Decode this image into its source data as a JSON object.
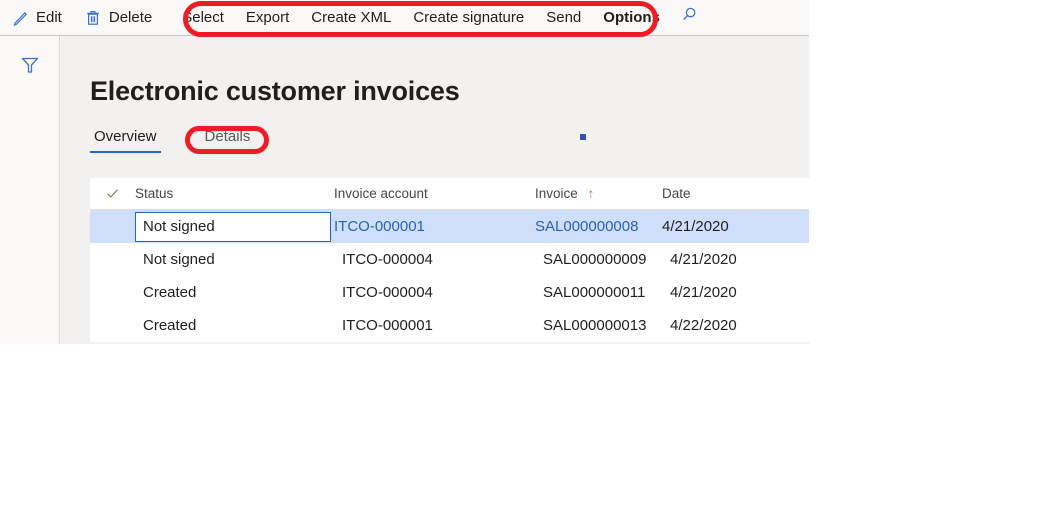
{
  "toolbar": {
    "items": [
      {
        "label": "Edit",
        "icon": "pencil-icon",
        "name": "edit-button",
        "bold": false
      },
      {
        "label": "Delete",
        "icon": "trash-icon",
        "name": "delete-button",
        "bold": false
      },
      {
        "label": "Select",
        "icon": "",
        "name": "select-button",
        "bold": false
      },
      {
        "label": "Export",
        "icon": "",
        "name": "export-button",
        "bold": false
      },
      {
        "label": "Create XML",
        "icon": "",
        "name": "create-xml-button",
        "bold": false
      },
      {
        "label": "Create signature",
        "icon": "",
        "name": "create-signature-button",
        "bold": false
      },
      {
        "label": "Send",
        "icon": "",
        "name": "send-button",
        "bold": false
      },
      {
        "label": "Options",
        "icon": "",
        "name": "options-button",
        "bold": true
      }
    ],
    "search_icon": "search-icon",
    "edit_label": "Edit",
    "delete_label": "Delete",
    "select_label": "Select",
    "export_label": "Export",
    "create_xml_label": "Create XML",
    "create_signature_label": "Create signature",
    "send_label": "Send",
    "options_label": "Options"
  },
  "rail": {
    "filter_icon": "filter-funnel-icon"
  },
  "page": {
    "title": "Electronic customer invoices"
  },
  "tabs": [
    {
      "label": "Overview",
      "active": true
    },
    {
      "label": "Details",
      "active": false
    }
  ],
  "tab_overview_label": "Overview",
  "tab_details_label": "Details",
  "grid": {
    "columns": [
      {
        "key": "check",
        "label": "",
        "name": "column-select-all"
      },
      {
        "key": "status",
        "label": "Status",
        "name": "column-status"
      },
      {
        "key": "account",
        "label": "Invoice account",
        "name": "column-invoice-account"
      },
      {
        "key": "invoice",
        "label": "Invoice",
        "name": "column-invoice",
        "sort": "ascending",
        "sort_glyph": "↑"
      },
      {
        "key": "date",
        "label": "Date",
        "name": "column-date"
      }
    ],
    "header": {
      "check_icon": "checkmark-icon",
      "status": "Status",
      "account": "Invoice account",
      "invoice": "Invoice",
      "invoice_sort_arrow": "↑",
      "date": "Date"
    },
    "rows": [
      {
        "status": "Not signed",
        "account": "ITCO-000001",
        "invoice": "SAL000000008",
        "date": "4/21/2020",
        "selected": true,
        "editing": true,
        "account_is_link": true,
        "invoice_is_link": true
      },
      {
        "status": "Not signed",
        "account": "ITCO-000004",
        "invoice": "SAL000000009",
        "date": "4/21/2020",
        "selected": false,
        "editing": false,
        "account_is_link": false,
        "invoice_is_link": false
      },
      {
        "status": "Created",
        "account": "ITCO-000004",
        "invoice": "SAL000000011",
        "date": "4/21/2020",
        "selected": false,
        "editing": false,
        "account_is_link": false,
        "invoice_is_link": false
      },
      {
        "status": "Created",
        "account": "ITCO-000001",
        "invoice": "SAL000000013",
        "date": "4/22/2020",
        "selected": false,
        "editing": false,
        "account_is_link": false,
        "invoice_is_link": false
      }
    ]
  },
  "annotations": [
    {
      "name": "annotation-toolbar-group",
      "shape": "ellipse",
      "color": "#ee1c25"
    },
    {
      "name": "annotation-details-tab",
      "shape": "ellipse",
      "color": "#ee1c25"
    }
  ],
  "colors": {
    "accent": "#2266cc",
    "link": "#2a63b5",
    "selected_row": "#cfdffa",
    "annotation": "#ee1c25",
    "chrome": "#faf9f8",
    "page_bg": "#f2f1f0"
  }
}
